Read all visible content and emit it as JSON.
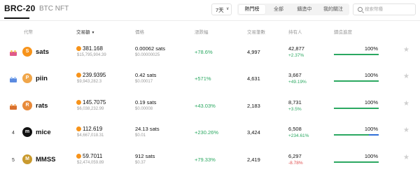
{
  "tabs": {
    "brc20": "BRC-20",
    "btc_nft": "BTC NFT"
  },
  "period": {
    "label": "7天",
    "chevron": "∨"
  },
  "segments": [
    "熱門榜",
    "全部",
    "鑄造中",
    "我的關注"
  ],
  "search": {
    "placeholder": "搜索幣種"
  },
  "headers": {
    "token": "代幣",
    "volume": "交易額",
    "price": "價格",
    "change": "漲跌幅",
    "txcount": "交易筆數",
    "holders": "持有人",
    "progress": "鑄造進度"
  },
  "colors": {
    "up": "#2ba861",
    "down": "#e04c4c",
    "btc": "#f7931a"
  },
  "rows": [
    {
      "rank": "",
      "ticker": "sats",
      "coin_letter": "S",
      "coin_color": "#f7931a",
      "volume_btc": "381.168",
      "volume_usd": "$15,795,904.39",
      "price": "0.00062 sats",
      "price_usd": "$0.00000025",
      "change": "+78.6%",
      "txcount": "4,997",
      "holders": "42,877",
      "holders_change": "+2.37%",
      "holders_dir": "up",
      "progress_text": "100%",
      "progress": 1.0
    },
    {
      "rank": "",
      "ticker": "piin",
      "coin_letter": "P",
      "coin_color": "#f0a64a",
      "volume_btc": "239.9395",
      "volume_usd": "$9,943,282.3",
      "price": "0.42 sats",
      "price_usd": "$0.00017",
      "change": "+571%",
      "txcount": "4,631",
      "holders": "3,667",
      "holders_change": "+49.19%",
      "holders_dir": "up",
      "progress_text": "100%",
      "progress": 1.0
    },
    {
      "rank": "",
      "ticker": "rats",
      "coin_letter": "R",
      "coin_color": "#e88a3a",
      "volume_btc": "145.7075",
      "volume_usd": "$6,038,232.99",
      "price": "0.19 sats",
      "price_usd": "$0.00008",
      "change": "+43.03%",
      "txcount": "2,183",
      "holders": "8,731",
      "holders_change": "+3.5%",
      "holders_dir": "up",
      "progress_text": "100%",
      "progress": 1.0
    },
    {
      "rank": "4",
      "ticker": "mice",
      "coin_letter": "m",
      "coin_color": "#111111",
      "volume_btc": "112.619",
      "volume_usd": "$4,667,018.31",
      "price": "24.13 sats",
      "price_usd": "$0.01",
      "change": "+230.26%",
      "txcount": "3,424",
      "holders": "6,508",
      "holders_change": "+234.61%",
      "holders_dir": "up",
      "progress_text": "100%",
      "progress": 1.0
    },
    {
      "rank": "5",
      "ticker": "MMSS",
      "coin_letter": "M",
      "coin_color": "#c99a2e",
      "volume_btc": "59.7011",
      "volume_usd": "$2,474,059.89",
      "price": "912 sats",
      "price_usd": "$0.37",
      "change": "+79.33%",
      "txcount": "2,419",
      "holders": "6,297",
      "holders_change": "-8.78%",
      "holders_dir": "down",
      "progress_text": "100%",
      "progress": 1.0
    }
  ]
}
